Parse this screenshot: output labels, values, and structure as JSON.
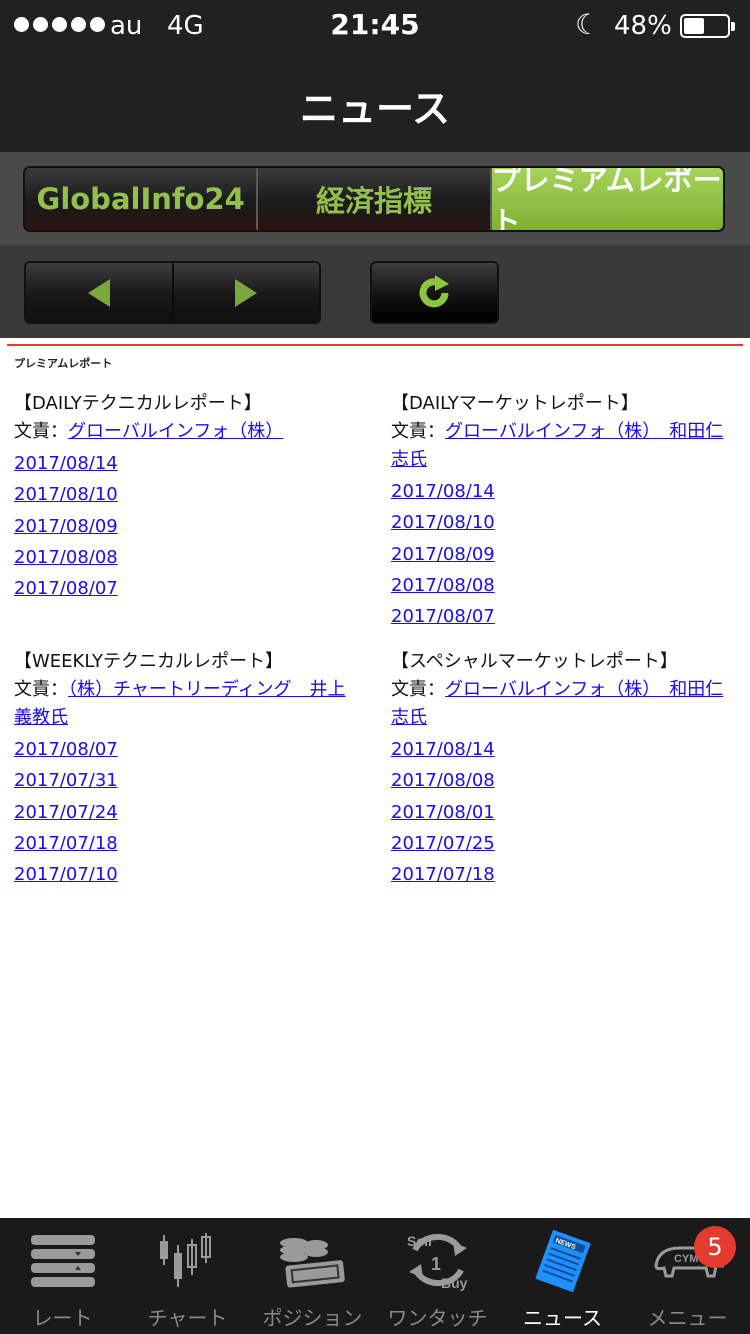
{
  "status": {
    "carrier": "au",
    "network": "4G",
    "time": "21:45",
    "battery": "48%",
    "battery_level": 0.48
  },
  "nav": {
    "title": "ニュース"
  },
  "tabs": [
    {
      "label": "GlobalInfo24",
      "active": false
    },
    {
      "label": "経済指標",
      "active": false
    },
    {
      "label": "プレミアムレポート",
      "active": true
    }
  ],
  "content": {
    "section_title": "プレミアムレポート",
    "author_prefix": "文責：",
    "reports": [
      {
        "title": "【DAILYテクニカルレポート】",
        "author": "グローバルインフォ（株）",
        "dates": [
          "2017/08/14",
          "2017/08/10",
          "2017/08/09",
          "2017/08/08",
          "2017/08/07"
        ]
      },
      {
        "title": "【DAILYマーケットレポート】",
        "author": "グローバルインフォ（株）　和田仁志氏",
        "dates": [
          "2017/08/14",
          "2017/08/10",
          "2017/08/09",
          "2017/08/08",
          "2017/08/07"
        ]
      },
      {
        "title": "【WEEKLYテクニカルレポート】",
        "author": "（株）チャートリーディング　井上義教氏",
        "dates": [
          "2017/08/07",
          "2017/07/31",
          "2017/07/24",
          "2017/07/18",
          "2017/07/10"
        ]
      },
      {
        "title": "【スペシャルマーケットレポート】",
        "author": "グローバルインフォ（株）　和田仁志氏",
        "dates": [
          "2017/08/14",
          "2017/08/08",
          "2017/08/01",
          "2017/07/25",
          "2017/07/18"
        ]
      }
    ]
  },
  "tabbar": {
    "items": [
      {
        "label": "レート",
        "icon": "rate-icon"
      },
      {
        "label": "チャート",
        "icon": "chart-icon"
      },
      {
        "label": "ポジション",
        "icon": "position-icon"
      },
      {
        "label": "ワンタッチ",
        "icon": "onetouch-icon",
        "icon_text_top": "Sell",
        "icon_text_mid": "1",
        "icon_text_bottom": "Buy"
      },
      {
        "label": "ニュース",
        "icon": "news-icon",
        "active": true,
        "icon_text": "NEWS"
      },
      {
        "label": "メニュー",
        "icon": "menu-icon",
        "badge": "5",
        "icon_text": "CYMO"
      }
    ]
  },
  "colors": {
    "accent_green": "#93c04a",
    "link": "#1a0dee",
    "red_line": "#e0393a",
    "news_blue": "#1e90ff"
  }
}
